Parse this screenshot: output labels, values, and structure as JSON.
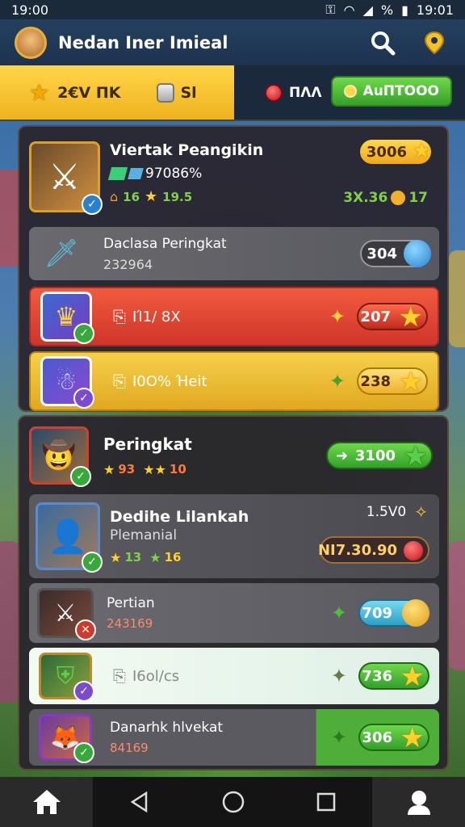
{
  "status": {
    "time_left": "19:00",
    "time_right": "19:01",
    "icons": [
      "key-icon",
      "wifi-icon",
      "signal-icon",
      "battery-icon"
    ],
    "percent": "%"
  },
  "header": {
    "title": "Nedan Iner Imieal"
  },
  "currency": {
    "stars": "2€V ΠK",
    "coins": "Sl",
    "gems": "ΠΛΛ",
    "auto_label": "AuΠΤΟΟΟ"
  },
  "top_panel": {
    "featured": {
      "name": "Viertak Peangikin",
      "stat": "97086%",
      "level": "16",
      "rating": "19.5",
      "reward": "3006",
      "bonus": "3Χ.36",
      "bonus_count": "17"
    },
    "row2": {
      "name": "Daclasa Peringkat",
      "value": "232964",
      "badge": "304"
    },
    "row3": {
      "label": "ΙΊ1/ 8Χ",
      "reward": "207"
    },
    "row4": {
      "label": "Ι0Ο% Ήeit",
      "reward": "238"
    }
  },
  "bottom_panel": {
    "row1": {
      "name": "Peringkat",
      "stars": "93",
      "stars2": "10",
      "reward": "3100"
    },
    "row2": {
      "name": "Dedihe Lilankah",
      "sub": "Plemanial",
      "s1": "13",
      "s2": "16",
      "value": "1.5V0",
      "price": "NI7.30.90"
    },
    "row3": {
      "name": "Pertian",
      "value": "243169",
      "reward": "709"
    },
    "row4": {
      "label": "Ι6ol/cs",
      "reward": "736"
    },
    "row5": {
      "name": "Danarhk hlvekat",
      "value": "84169",
      "reward": "306"
    }
  },
  "colors": {
    "gold": "#ffcf2a",
    "red_row": "#e0412e",
    "yellow_row": "#f2c22a",
    "green": "#4fbe3a",
    "blue_pill": "#3fb8d8"
  }
}
